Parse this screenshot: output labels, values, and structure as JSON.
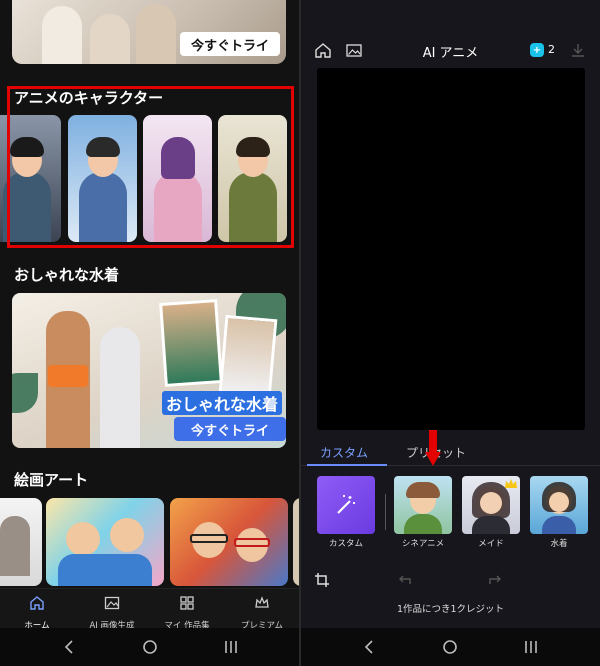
{
  "left": {
    "top_banner": {
      "button_label": "今すぐトライ"
    },
    "anime_section": {
      "title": "アニメのキャラクター"
    },
    "swimsuit_section": {
      "title": "おしゃれな水着",
      "banner_text": "おしゃれな水着",
      "button_label": "今すぐトライ"
    },
    "art_section": {
      "title": "絵画アート"
    },
    "nav": [
      {
        "label": "ホーム",
        "icon": "home-icon"
      },
      {
        "label": "AI 画像生成",
        "icon": "image-generate-icon"
      },
      {
        "label": "マイ 作品集",
        "icon": "grid-icon"
      },
      {
        "label": "プレミアム",
        "icon": "crown-icon"
      }
    ]
  },
  "right": {
    "header": {
      "title": "AI アニメ",
      "credits": "2"
    },
    "tabs": [
      {
        "label": "カスタム"
      },
      {
        "label": "プリセット"
      }
    ],
    "styles": [
      {
        "label": "カスタム"
      },
      {
        "label": "シネアニメ"
      },
      {
        "label": "メイド"
      },
      {
        "label": "水着"
      }
    ],
    "credit_note": "1作品につき1クレジット"
  },
  "colors": {
    "accent": "#6b8cff",
    "highlight": "#e30000",
    "badge": "#19c2e8"
  }
}
